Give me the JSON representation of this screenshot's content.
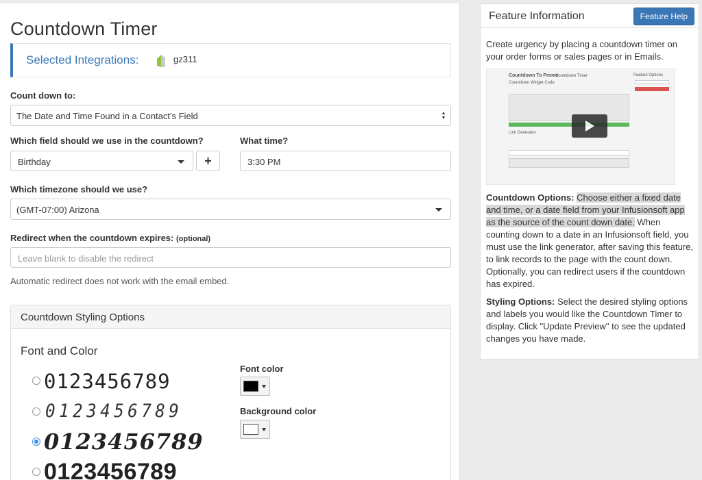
{
  "main": {
    "title": "Countdown Timer",
    "integrations": {
      "label": "Selected Integrations:",
      "name": "gz311"
    },
    "count_down_to": {
      "label": "Count down to:",
      "value": "The Date and Time Found in a Contact's Field"
    },
    "field": {
      "label": "Which field should we use in the countdown?",
      "value": "Birthday",
      "add_label": "+"
    },
    "time": {
      "label": "What time?",
      "value": "3:30 PM"
    },
    "timezone": {
      "label": "Which timezone should we use?",
      "value": "(GMT-07:00) Arizona"
    },
    "redirect": {
      "label": "Redirect when the countdown expires:",
      "optional": "(optional)",
      "placeholder": "Leave blank to disable the redirect",
      "help": "Automatic redirect does not work with the email embed."
    },
    "styling": {
      "header": "Countdown Styling Options",
      "subheading": "Font and Color",
      "font_samples": [
        {
          "text": "0123456789",
          "selected": false
        },
        {
          "text": "0123456789",
          "selected": false
        },
        {
          "text": "0123456789",
          "selected": true
        },
        {
          "text": "0123456789",
          "selected": false
        }
      ],
      "font_color": {
        "label": "Font color",
        "value": "#000000"
      },
      "background_color": {
        "label": "Background color",
        "value": "#ffffff"
      }
    }
  },
  "side": {
    "title": "Feature Information",
    "help_button": "Feature Help",
    "intro": "Create urgency by placing a countdown timer on your order forms or sales pages or in Emails.",
    "video": {
      "title": "Countdown To Promo",
      "subtitle": "Countdown Timer",
      "widget_heading": "Countdown Widget Code",
      "options_heading": "Feature Options",
      "link_heading": "Link Generator"
    },
    "countdown_options": {
      "label": "Countdown Options:",
      "highlighted": "Choose either a fixed date and time, or a date field from your Infusionsoft app as the source of the count down date.",
      "rest": " When counting down to a date in an Infusionsoft field, you must use the link generator, after saving this feature, to link records to the page with the count down. Optionally, you can redirect users if the countdown has expired."
    },
    "styling_options": {
      "label": "Styling Options:",
      "text": " Select the desired styling options and labels you would like the Countdown Timer to display. Click \"Update Preview\" to see the updated changes you have made."
    }
  },
  "colors": {
    "accent": "#3a79b6",
    "button": "#3a77b5",
    "radio_selected": "#3d8fe8"
  }
}
